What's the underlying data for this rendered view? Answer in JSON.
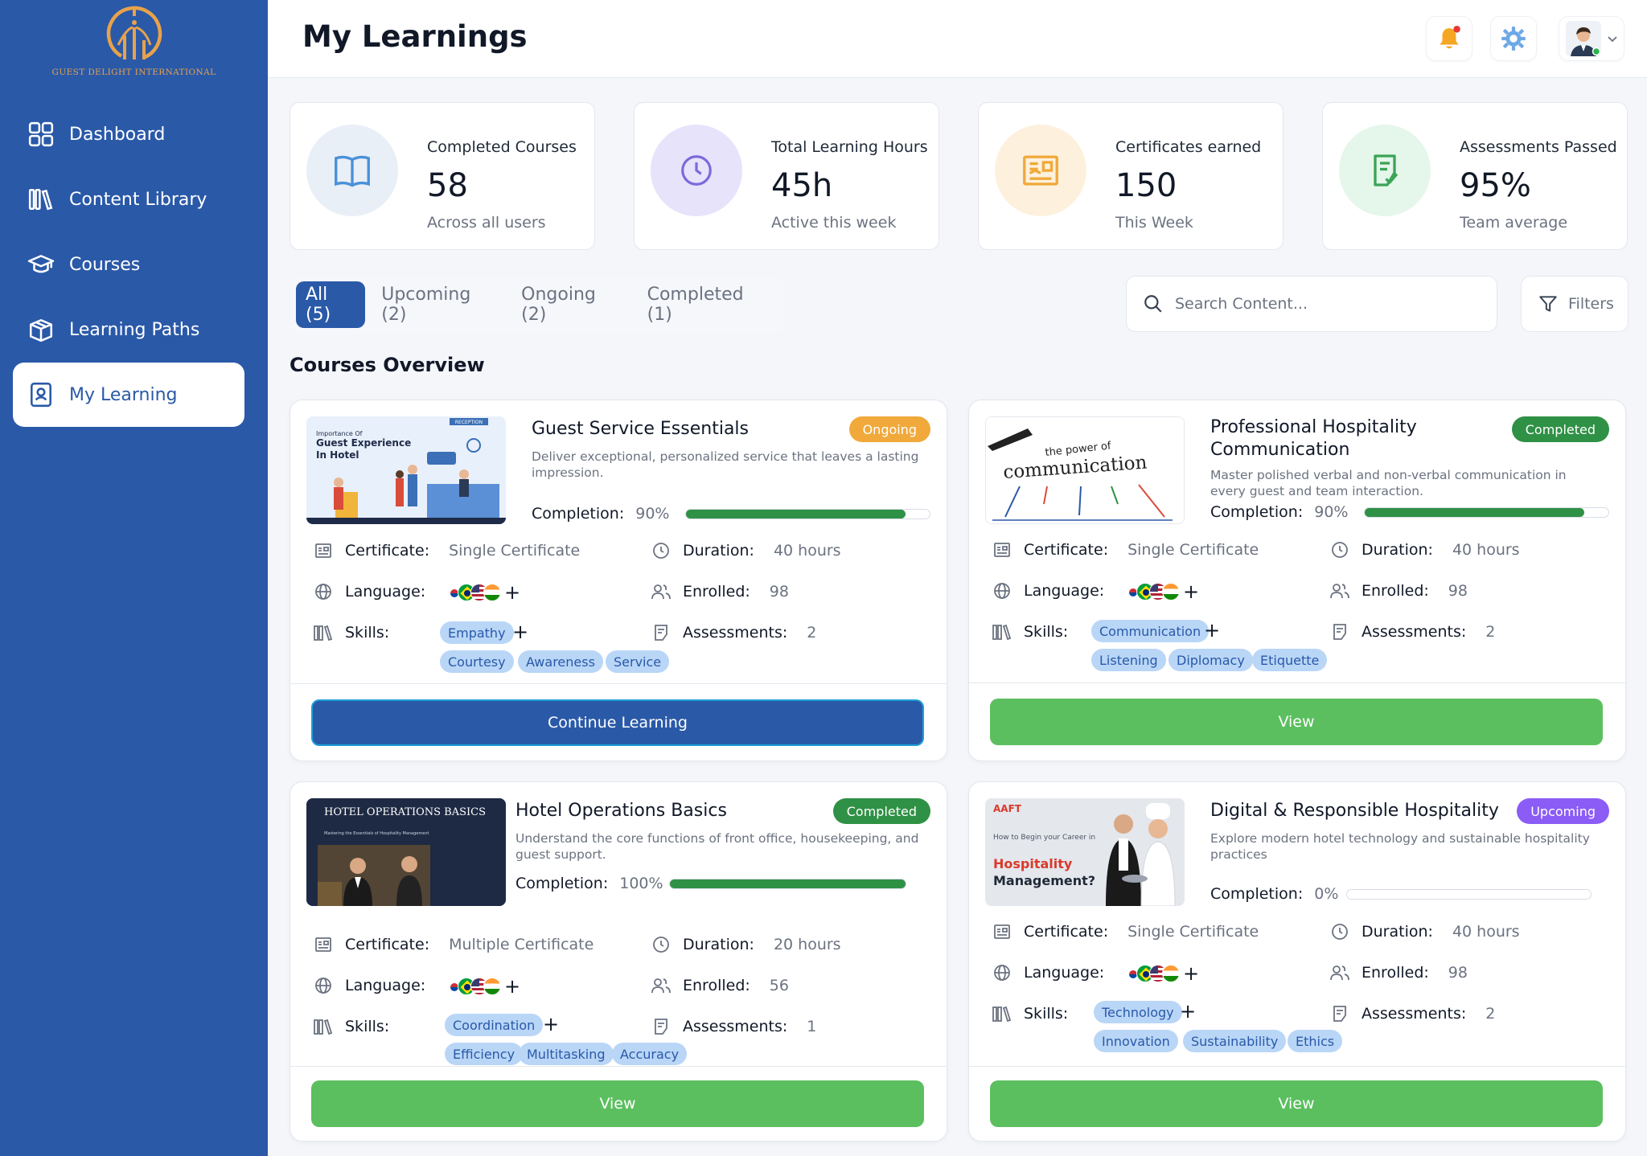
{
  "brand": {
    "name": "GUEST DELIGHT INTERNATIONAL"
  },
  "nav": [
    {
      "label": "Dashboard",
      "icon": "grid-icon"
    },
    {
      "label": "Content Library",
      "icon": "library-icon"
    },
    {
      "label": "Courses",
      "icon": "graduation-cap-icon"
    },
    {
      "label": "Learning Paths",
      "icon": "box-icon"
    },
    {
      "label": "My Learning",
      "icon": "contact-book-icon",
      "active": true
    }
  ],
  "header": {
    "title": "My Learnings"
  },
  "stats": [
    {
      "label": "Completed Courses",
      "value": "58",
      "sub": "Across all users",
      "icon": "book-open-icon",
      "color": "#e9eff7",
      "iconColor": "#4a90d9"
    },
    {
      "label": "Total Learning Hours",
      "value": "45h",
      "sub": "Active this week",
      "icon": "clock-icon",
      "color": "#e6e3fb",
      "iconColor": "#7b6ad9"
    },
    {
      "label": "Certificates earned",
      "value": "150",
      "sub": "This Week",
      "icon": "certificate-icon",
      "color": "#fdf1de",
      "iconColor": "#f0a93a"
    },
    {
      "label": "Assessments Passed",
      "value": "95%",
      "sub": "Team average",
      "icon": "clipboard-check-icon",
      "color": "#e5f6ea",
      "iconColor": "#3aa556"
    }
  ],
  "tabs": [
    "All (5)",
    "Upcoming (2)",
    "Ongoing (2)",
    "Completed (1)"
  ],
  "search": {
    "placeholder": "Search Content..."
  },
  "filters": {
    "label": "Filters"
  },
  "section_title": "Courses Overview",
  "labels": {
    "completion": "Completion:",
    "certificate": "Certificate:",
    "language": "Language:",
    "skills": "Skills:",
    "duration": "Duration:",
    "enrolled": "Enrolled:",
    "assessments": "Assessments:"
  },
  "courses": [
    {
      "title": "Guest Service Essentials",
      "status": "Ongoing",
      "status_color": "#f0a93a",
      "description": "Deliver exceptional, personalized service that leaves a lasting impression.",
      "completion": "90%",
      "completion_value": 0.9,
      "certificate": "Single Certificate",
      "duration": "40 hours",
      "enrolled": "98",
      "assessments": "2",
      "skills": [
        "Empathy",
        "Courtesy",
        "Awareness",
        "Service"
      ],
      "button": "Continue Learning",
      "button_style": "blue",
      "thumb": {
        "line1": "Importance Of",
        "line2": "Guest Experience",
        "line3": "In Hotel",
        "tag": "RECEPTION"
      }
    },
    {
      "title": "Professional Hospitality Communication",
      "status": "Completed",
      "status_color": "#2f9145",
      "description": "Master polished verbal and non-verbal communication in every guest and team interaction.",
      "completion": "90%",
      "completion_value": 0.9,
      "certificate": "Single Certificate",
      "duration": "40 hours",
      "enrolled": "98",
      "assessments": "2",
      "skills": [
        "Communication",
        "Listening",
        "Diplomacy",
        "Etiquette"
      ],
      "button": "View",
      "button_style": "green",
      "thumb": {
        "line1": "the power of",
        "line2": "communication"
      }
    },
    {
      "title": "Hotel Operations Basics",
      "status": "Completed",
      "status_color": "#2f9145",
      "description": "Understand the core functions of front office, housekeeping, and guest support.",
      "completion": "100%",
      "completion_value": 1.0,
      "certificate": "Multiple Certificate",
      "duration": "20 hours",
      "enrolled": "56",
      "assessments": "1",
      "skills": [
        "Coordination",
        "Efficiency",
        "Multitasking",
        "Accuracy"
      ],
      "button": "View",
      "button_style": "green",
      "thumb": {
        "line1": "HOTEL OPERATIONS BASICS",
        "line2": "Mastering the Essentials of Hospitality Management"
      }
    },
    {
      "title": "Digital & Responsible Hospitality",
      "status": "Upcoming",
      "status_color": "#8b5cf6",
      "description": "Explore modern hotel technology and sustainable hospitality practices",
      "completion": "0%",
      "completion_value": 0,
      "certificate": "Single Certificate",
      "duration": "40 hours",
      "enrolled": "98",
      "assessments": "2",
      "skills": [
        "Technology",
        "Innovation",
        "Sustainability",
        "Ethics"
      ],
      "button": "View",
      "button_style": "green",
      "thumb": {
        "tag": "AAFT",
        "line1": "How to Begin your Career in",
        "line2": "Hospitality",
        "line3": "Management?"
      }
    }
  ]
}
